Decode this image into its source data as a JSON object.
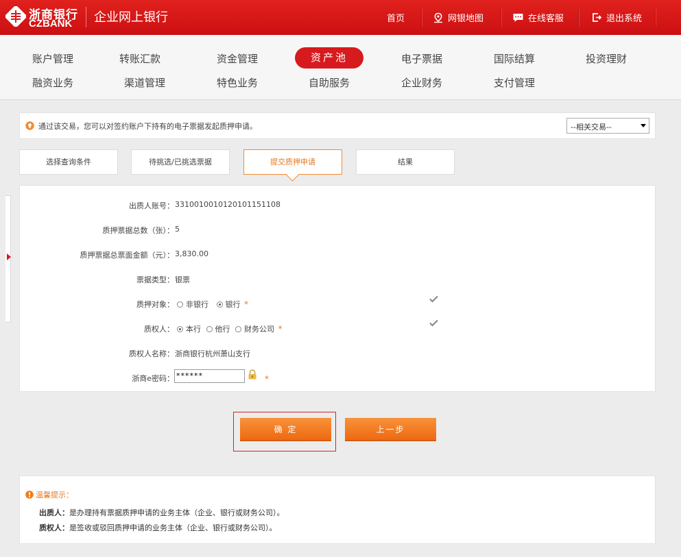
{
  "header": {
    "logo_cn": "浙商银行",
    "logo_en": "CZBANK",
    "app_title": "企业网上银行",
    "nav": [
      {
        "label": "首页",
        "icon": ""
      },
      {
        "label": "网银地图",
        "icon": "map-pin-icon"
      },
      {
        "label": "在线客服",
        "icon": "chat-icon"
      },
      {
        "label": "退出系统",
        "icon": "logout-icon"
      }
    ]
  },
  "menu": {
    "row1": [
      "账户管理",
      "转账汇款",
      "资金管理",
      "资产池",
      "电子票据",
      "国际结算",
      "投资理财"
    ],
    "row2": [
      "融资业务",
      "渠道管理",
      "特色业务",
      "自助服务",
      "企业财务",
      "支付管理"
    ],
    "active": "资产池"
  },
  "notice": {
    "text": "通过该交易，您可以对签约账户下持有的电子票据发起质押申请。",
    "related_select": "--相关交易--"
  },
  "steps": [
    "选择查询条件",
    "待挑选/已挑选票据",
    "提交质押申请",
    "结果"
  ],
  "form": {
    "pledgor_account_label": "出质人账号：",
    "pledgor_account": "3310010010120101151108",
    "total_count_label": "质押票据总数（张）：",
    "total_count": "5",
    "total_amount_label": "质押票据总票面金额（元）：",
    "total_amount": "3,830.00",
    "bill_type_label": "票据类型：",
    "bill_type": "银票",
    "target_label": "质押对象：",
    "target_options": [
      "非银行",
      "银行"
    ],
    "target_selected": "银行",
    "pledgee_label": "质权人：",
    "pledgee_options": [
      "本行",
      "他行",
      "财务公司"
    ],
    "pledgee_selected": "本行",
    "pledgee_name_label": "质权人名称：",
    "pledgee_name": "浙商银行杭州萧山支行",
    "password_label": "浙商e密码：",
    "password_value": "******",
    "required_mark": "*"
  },
  "buttons": {
    "confirm": "确 定",
    "previous": "上一步"
  },
  "tips": {
    "title": "温馨提示：",
    "line1_term": "出质人：",
    "line1_text": "是办理持有票据质押申请的业务主体（企业、银行或财务公司）。",
    "line2_term": "质权人：",
    "line2_text": "是签收或驳回质押申请的业务主体（企业、银行或财务公司）。"
  },
  "colors": {
    "brand_red": "#d71a1d",
    "accent_orange": "#f08c35"
  }
}
